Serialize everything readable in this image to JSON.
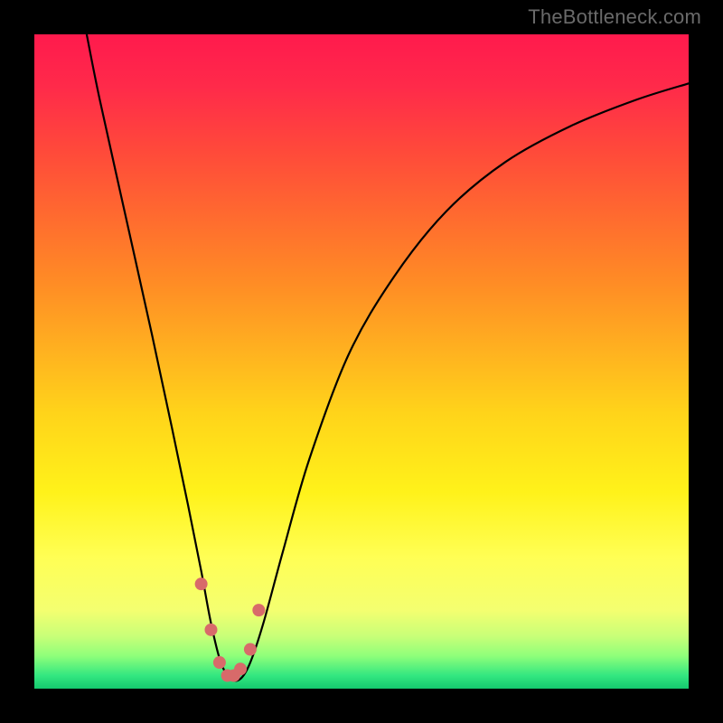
{
  "attribution": "TheBottleneck.com",
  "chart_data": {
    "type": "line",
    "title": "",
    "xlabel": "",
    "ylabel": "",
    "xlim": [
      0,
      100
    ],
    "ylim": [
      0,
      100
    ],
    "series": [
      {
        "name": "bottleneck-curve",
        "x": [
          8,
          10,
          14,
          18,
          21,
          23.5,
          25.5,
          27,
          28.5,
          30,
          31.5,
          33,
          35,
          38,
          42,
          48,
          55,
          63,
          72,
          82,
          92,
          100
        ],
        "values": [
          100,
          90,
          72,
          54,
          40,
          28,
          18,
          10,
          4,
          1.5,
          1.5,
          4,
          10,
          21,
          35,
          51,
          63,
          73,
          80.5,
          86,
          90,
          92.5
        ]
      }
    ],
    "markers": {
      "name": "highlight-dots",
      "color": "#d86a6a",
      "x": [
        25.5,
        27.0,
        28.3,
        29.5,
        30.5,
        31.5,
        33.0,
        34.3
      ],
      "values": [
        16.0,
        9.0,
        4.0,
        2.0,
        2.0,
        3.0,
        6.0,
        12.0
      ]
    }
  }
}
